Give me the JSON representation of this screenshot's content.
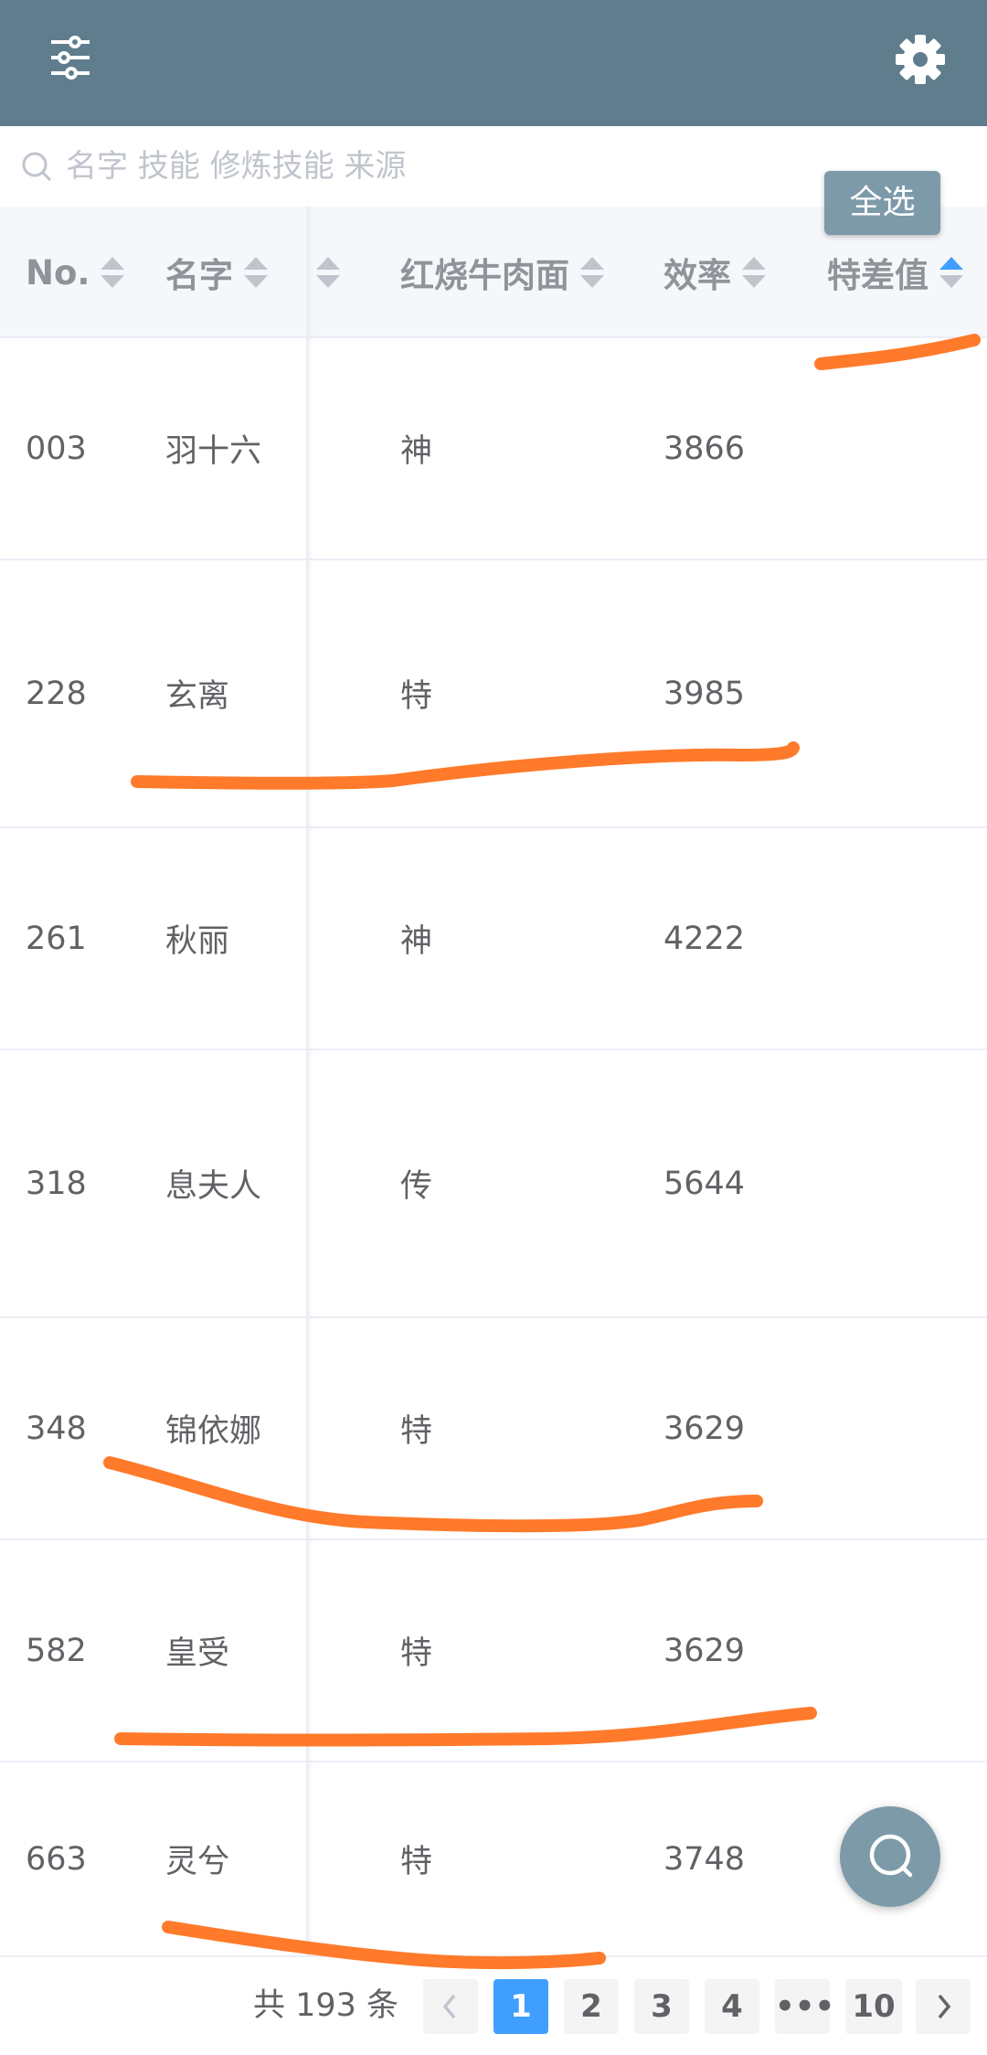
{
  "header": {
    "menu_icon": "sliders-icon",
    "settings_icon": "gear-icon"
  },
  "search": {
    "placeholder": "名字 技能 修炼技能 来源",
    "icon": "search-icon"
  },
  "select_all_label": "全选",
  "table": {
    "columns": [
      {
        "label": "No.",
        "sort": "none"
      },
      {
        "label": "名字",
        "sort": "none"
      },
      {
        "label": "",
        "sort": "none"
      },
      {
        "label": "红烧牛肉面",
        "sort": "none"
      },
      {
        "label": "效率",
        "sort": "none"
      },
      {
        "label": "特差值",
        "sort": "ascending"
      }
    ],
    "rows": [
      {
        "no": "003",
        "name": "羽十六",
        "grade": "神",
        "efficiency": "3866",
        "diff": ""
      },
      {
        "no": "228",
        "name": "玄离",
        "grade": "特",
        "efficiency": "3985",
        "diff": ""
      },
      {
        "no": "261",
        "name": "秋丽",
        "grade": "神",
        "efficiency": "4222",
        "diff": ""
      },
      {
        "no": "318",
        "name": "息夫人",
        "grade": "传",
        "efficiency": "5644",
        "diff": ""
      },
      {
        "no": "348",
        "name": "锦依娜",
        "grade": "特",
        "efficiency": "3629",
        "diff": ""
      },
      {
        "no": "582",
        "name": "皇受",
        "grade": "特",
        "efficiency": "3629",
        "diff": ""
      },
      {
        "no": "663",
        "name": "灵兮",
        "grade": "特",
        "efficiency": "3748",
        "diff": ""
      }
    ]
  },
  "fab_icon": "search-icon",
  "pagination": {
    "total": "共 193 条",
    "prev_icon": "chevron-left-icon",
    "next_icon": "chevron-right-icon",
    "pages": [
      "1",
      "2",
      "3",
      "4",
      "•••",
      "10"
    ],
    "current": "1"
  },
  "colors": {
    "header_bg": "#5f7d8c",
    "accent": "#409eff",
    "annotation": "#ff7a2a"
  }
}
